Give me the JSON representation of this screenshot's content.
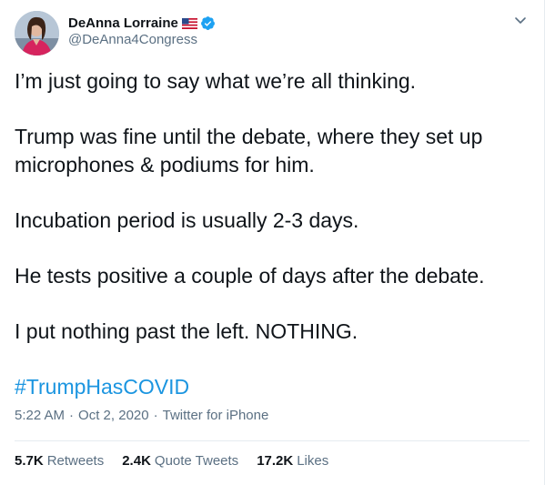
{
  "author": {
    "display_name": "DeAnna Lorraine",
    "handle": "@DeAnna4Congress",
    "flag_icon": "us-flag-icon",
    "verified_icon": "verified-badge-icon"
  },
  "tweet": {
    "lines": [
      "I’m just going to say what we’re all thinking.",
      "Trump was fine until the debate, where they set up",
      "microphones & podiums for him.",
      "Incubation period is usually 2-3 days.",
      "He tests positive a couple of days after the debate.",
      "I put nothing past the left. NOTHING."
    ],
    "hashtag": "#TrumpHasCOVID"
  },
  "meta": {
    "time": "5:22 AM",
    "separator1": "·",
    "date": "Oct 2, 2020",
    "separator2": "·",
    "source": "Twitter for iPhone"
  },
  "stats": {
    "retweets_count": "5.7K",
    "retweets_label": "Retweets",
    "quotes_count": "2.4K",
    "quotes_label": "Quote Tweets",
    "likes_count": "17.2K",
    "likes_label": "Likes"
  },
  "colors": {
    "accent": "#1b95e0",
    "secondary_text": "#5b7083",
    "verified": "#1da1f2"
  }
}
